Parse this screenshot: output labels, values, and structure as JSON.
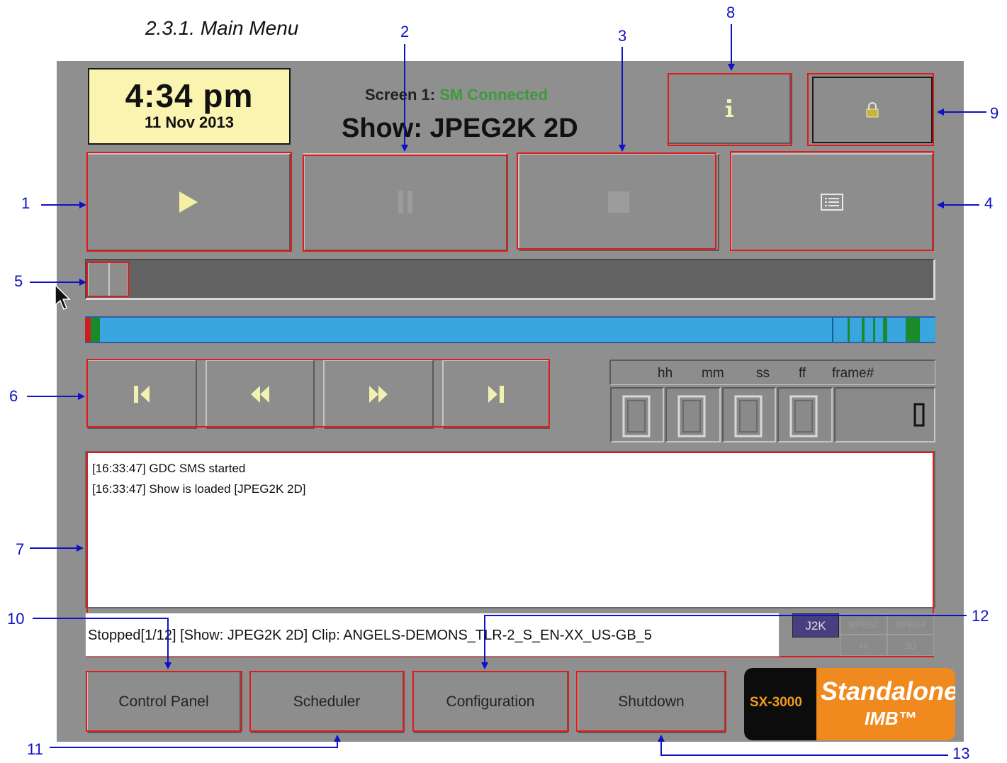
{
  "document": {
    "heading": "2.3.1. Main Menu"
  },
  "clock": {
    "time": "4:34 pm",
    "date": "11 Nov 2013"
  },
  "screen": {
    "label": "Screen 1:",
    "status": "SM Connected",
    "show": "Show: JPEG2K 2D"
  },
  "timecode": {
    "headers": [
      "hh",
      "mm",
      "ss",
      "ff",
      "frame#"
    ],
    "values": [
      "0",
      "0",
      "0",
      "0",
      "0"
    ]
  },
  "log": {
    "lines": [
      "[16:33:47] GDC SMS started",
      "[16:33:47] Show is loaded [JPEG2K 2D]"
    ]
  },
  "status_line": "Stopped[1/12] [Show: JPEG2K 2D] Clip: ANGELS-DEMONS_TLR-2_S_EN-XX_US-GB_5",
  "formats": {
    "active": "J2K",
    "inactive": [
      "MPEG2",
      "MPEG4",
      "4K",
      "3D"
    ]
  },
  "nav": {
    "control_panel": "Control Panel",
    "scheduler": "Scheduler",
    "configuration": "Configuration",
    "shutdown": "Shutdown"
  },
  "logo": {
    "model": "SX-3000",
    "line1": "Standalone",
    "line2": "IMB™"
  },
  "callouts": [
    "1",
    "2",
    "3",
    "4",
    "5",
    "6",
    "7",
    "8",
    "9",
    "10",
    "11",
    "12",
    "13"
  ],
  "colors": {
    "panel": "#8f8f8f",
    "highlight": "#e11a1a",
    "callout": "#1010c8",
    "playlist": "#3aa6e0",
    "connected": "#3d9a3d"
  },
  "icons": [
    "play-icon",
    "pause-icon",
    "stop-icon",
    "playlist-icon",
    "info-icon",
    "lock-icon",
    "skip-start-icon",
    "rewind-icon",
    "fast-forward-icon",
    "skip-end-icon"
  ]
}
